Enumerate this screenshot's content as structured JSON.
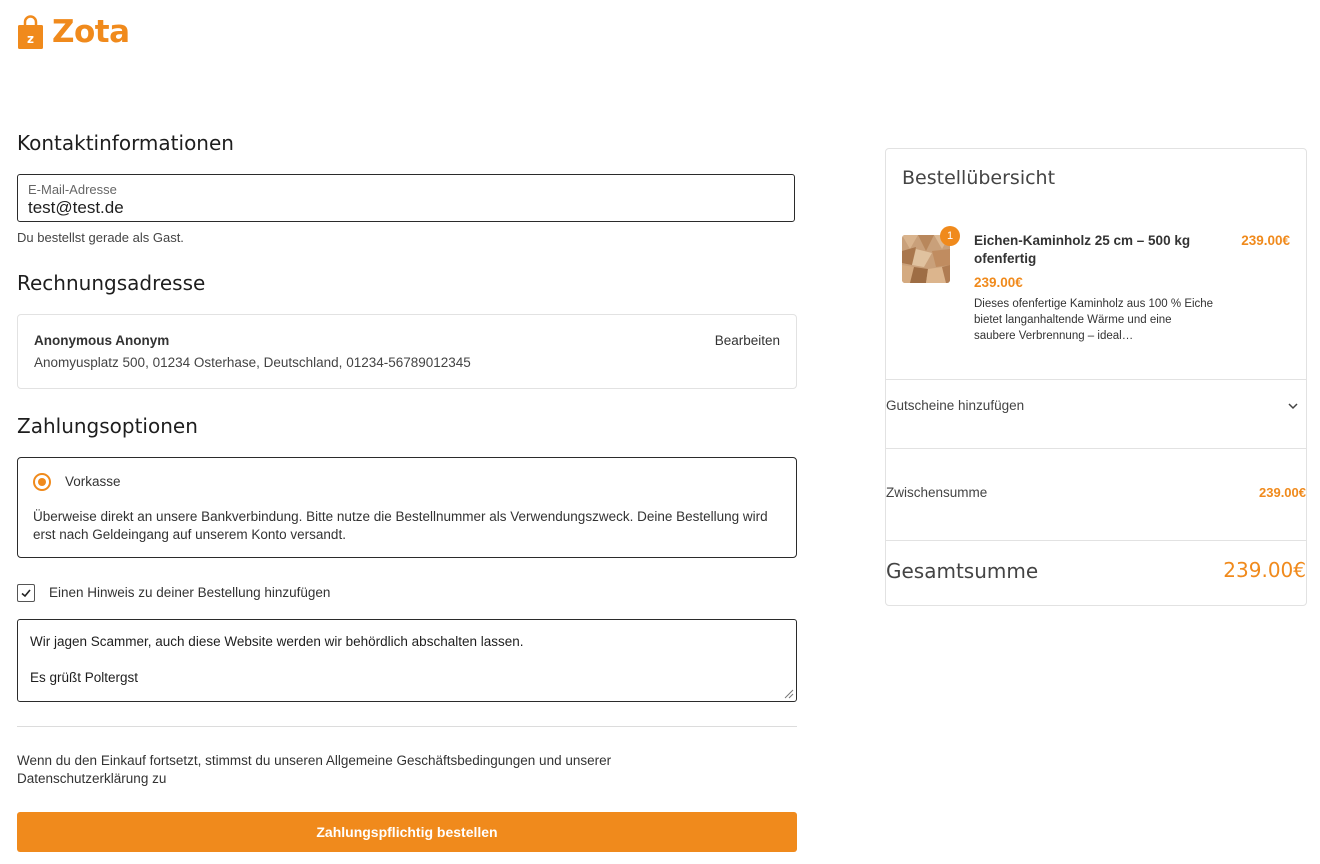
{
  "brand": {
    "name": "Zota",
    "logo_letter": "z",
    "accent_color": "#f08a1c"
  },
  "contact": {
    "heading": "Kontaktinformationen",
    "email_label": "E-Mail-Adresse",
    "email_value": "test@test.de",
    "guest_note": "Du bestellst gerade als Gast."
  },
  "billing": {
    "heading": "Rechnungsadresse",
    "name": "Anonymous Anonym",
    "address": "Anomyusplatz 500, 01234 Osterhase, Deutschland, 01234-56789012345",
    "edit_label": "Bearbeiten"
  },
  "payment": {
    "heading": "Zahlungsoptionen",
    "method_label": "Vorkasse",
    "method_selected": true,
    "description": "Überweise direkt an unsere Bankverbindung. Bitte nutze die Bestellnummer als Verwendungszweck. Deine Bestellung wird erst nach Geldeingang auf unserem Konto versandt."
  },
  "order_note": {
    "checkbox_label": "Einen Hinweis zu deiner Bestellung hinzufügen",
    "checked": true,
    "text_line1": "Wir jagen Scammer, auch diese Website werden wir behördlich abschalten lassen.",
    "text_line2": "Es grüßt Poltergst"
  },
  "terms_text": "Wenn du den Einkauf fortsetzt, stimmst du unseren Allgemeine Geschäftsbedingungen und unserer Datenschutzerklärung zu",
  "order_button_label": "Zahlungspflichtig bestellen",
  "summary": {
    "heading": "Bestellübersicht",
    "item": {
      "quantity": "1",
      "name": "Eichen-Kaminholz 25 cm – 500 kg ofenfertig",
      "price": "239.00€",
      "line_total": "239.00€",
      "description": "Dieses ofenfertige Kaminholz aus 100 % Eiche bietet langanhaltende Wärme und eine saubere Verbrennung – ideal…",
      "image_icon": "firewood-image"
    },
    "coupon_label": "Gutscheine hinzufügen",
    "subtotal_label": "Zwischensumme",
    "subtotal_value": "239.00€",
    "total_label": "Gesamtsumme",
    "total_value": "239.00€"
  }
}
